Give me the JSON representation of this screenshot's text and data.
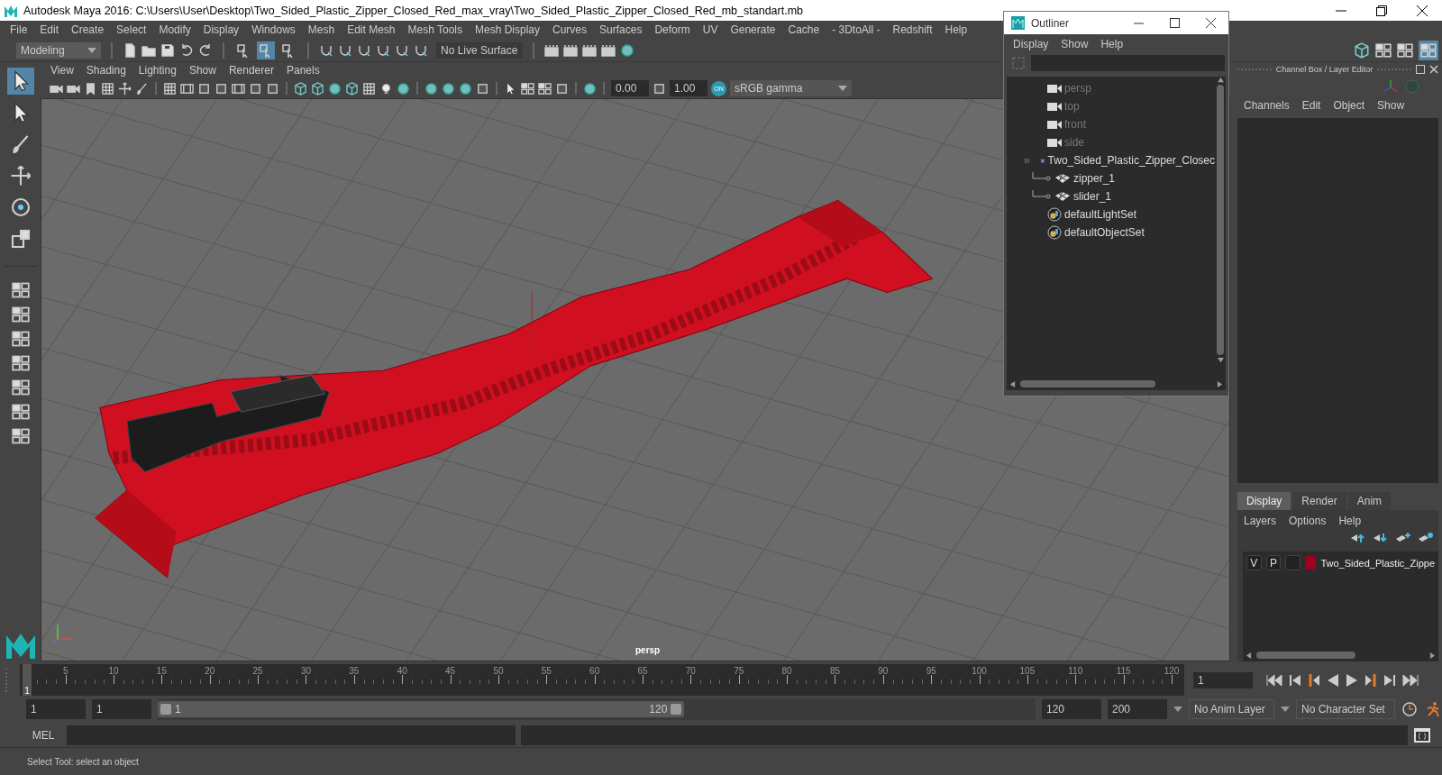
{
  "window": {
    "title": "Autodesk Maya 2016: C:\\Users\\User\\Desktop\\Two_Sided_Plastic_Zipper_Closed_Red_max_vray\\Two_Sided_Plastic_Zipper_Closed_Red_mb_standart.mb"
  },
  "menu_bar": [
    "File",
    "Edit",
    "Create",
    "Select",
    "Modify",
    "Display",
    "Windows",
    "Mesh",
    "Edit Mesh",
    "Mesh Tools",
    "Mesh Display",
    "Curves",
    "Surfaces",
    "Deform",
    "UV",
    "Generate",
    "Cache",
    "- 3DtoAll -",
    "Redshift",
    "Help"
  ],
  "shelf": {
    "mode": "Modeling",
    "live_surface": "No Live Surface",
    "select_modes": [
      {
        "selected": false
      },
      {
        "selected": true
      },
      {
        "selected": false
      }
    ]
  },
  "viewport": {
    "menu": [
      "View",
      "Shading",
      "Lighting",
      "Show",
      "Renderer",
      "Panels"
    ],
    "exposure": "0.00",
    "gamma": "1.00",
    "color_management_badge": "ON",
    "color_space": "sRGB gamma",
    "camera_label": "persp"
  },
  "outliner": {
    "title": "Outliner",
    "menu": [
      "Display",
      "Show",
      "Help"
    ],
    "items": [
      {
        "label": "persp",
        "kind": "camera"
      },
      {
        "label": "top",
        "kind": "camera"
      },
      {
        "label": "front",
        "kind": "camera"
      },
      {
        "label": "side",
        "kind": "camera"
      },
      {
        "label": "Two_Sided_Plastic_Zipper_Closec",
        "kind": "group",
        "expanded": true,
        "children": [
          {
            "label": "zipper_1",
            "kind": "mesh"
          },
          {
            "label": "slider_1",
            "kind": "mesh"
          }
        ]
      },
      {
        "label": "defaultLightSet",
        "kind": "set"
      },
      {
        "label": "defaultObjectSet",
        "kind": "set"
      }
    ]
  },
  "channel_box": {
    "title": "Channel Box / Layer Editor",
    "menu": [
      "Channels",
      "Edit",
      "Object",
      "Show"
    ]
  },
  "layer_editor": {
    "tabs": [
      {
        "label": "Display",
        "selected": true
      },
      {
        "label": "Render",
        "selected": false
      },
      {
        "label": "Anim",
        "selected": false
      }
    ],
    "menu": [
      "Layers",
      "Options",
      "Help"
    ],
    "layers": [
      {
        "visible": "V",
        "playback": "P",
        "color": "#a00020",
        "name": "Two_Sided_Plastic_Zippe"
      }
    ]
  },
  "time_slider": {
    "current_frame": "1",
    "level": 0,
    "labels": [
      "5",
      "10",
      "15",
      "20",
      "25",
      "30",
      "35",
      "40",
      "45",
      "50",
      "55",
      "60",
      "65",
      "70",
      "75",
      "80",
      "85",
      "90",
      "95",
      "100",
      "105",
      "110",
      "115",
      "120"
    ]
  },
  "playback": {
    "frame": "1"
  },
  "range_slider": {
    "level": 0.6,
    "start": "1",
    "playback_start": "1",
    "range_start": "1",
    "range_end": "120",
    "playback_end": "120",
    "end": "200",
    "anim_layer": "No Anim Layer",
    "character_set": "No Character Set"
  },
  "command_line": {
    "language": "MEL"
  },
  "help_line": "Select Tool: select an object"
}
